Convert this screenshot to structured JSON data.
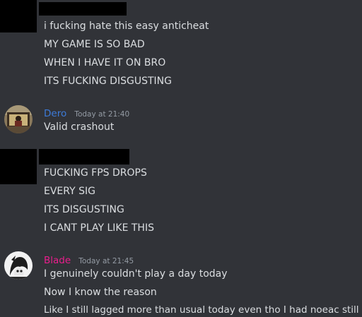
{
  "messages": [
    {
      "author": "",
      "author_redacted": true,
      "lines": [
        "i fucking hate this easy anticheat",
        "MY GAME IS SO BAD",
        "WHEN I HAVE IT ON BRO",
        "ITS FUCKING DISGUSTING"
      ]
    },
    {
      "author": "Dero",
      "author_color": "#3d7bd9",
      "timestamp": "Today at 21:40",
      "lines": [
        "Valid crashout"
      ]
    },
    {
      "author": "",
      "author_redacted": true,
      "lines": [
        "FUCKING FPS DROPS",
        "EVERY SIG",
        "ITS DISGUSTING",
        "I CANT PLAY LIKE THIS"
      ]
    },
    {
      "author": "Blade",
      "author_color": "#e91e8c",
      "timestamp": "Today at 21:45",
      "lines": [
        "I genuinely couldn't play a day today",
        "Now I know the reason",
        "Like I still lagged more than usual today even tho I had noeac still"
      ]
    }
  ],
  "colors": {
    "background": "#313338",
    "text": "#dbdee1",
    "timestamp": "#949ba4",
    "redaction": "#000000"
  }
}
